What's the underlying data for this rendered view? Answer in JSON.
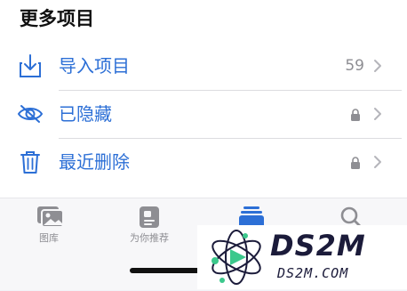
{
  "section": {
    "title": "更多项目"
  },
  "rows": [
    {
      "label": "导入项目",
      "count": "59",
      "icon": "import-icon"
    },
    {
      "label": "已隐藏",
      "icon": "hidden-eye-icon",
      "locked": true
    },
    {
      "label": "最近删除",
      "icon": "trash-icon",
      "locked": true
    }
  ],
  "tabs": [
    {
      "label": "图库",
      "icon": "library-icon"
    },
    {
      "label": "为你推荐",
      "icon": "for-you-icon"
    },
    {
      "label": "",
      "icon": "albums-icon",
      "active": true
    },
    {
      "label": "",
      "icon": "search-icon"
    }
  ],
  "watermark": {
    "text": "DS2M",
    "sub": "DS2M.COM"
  },
  "colors": {
    "accent": "#2c6fd6",
    "secondary": "#8e8e93",
    "background": "#ffffff"
  }
}
